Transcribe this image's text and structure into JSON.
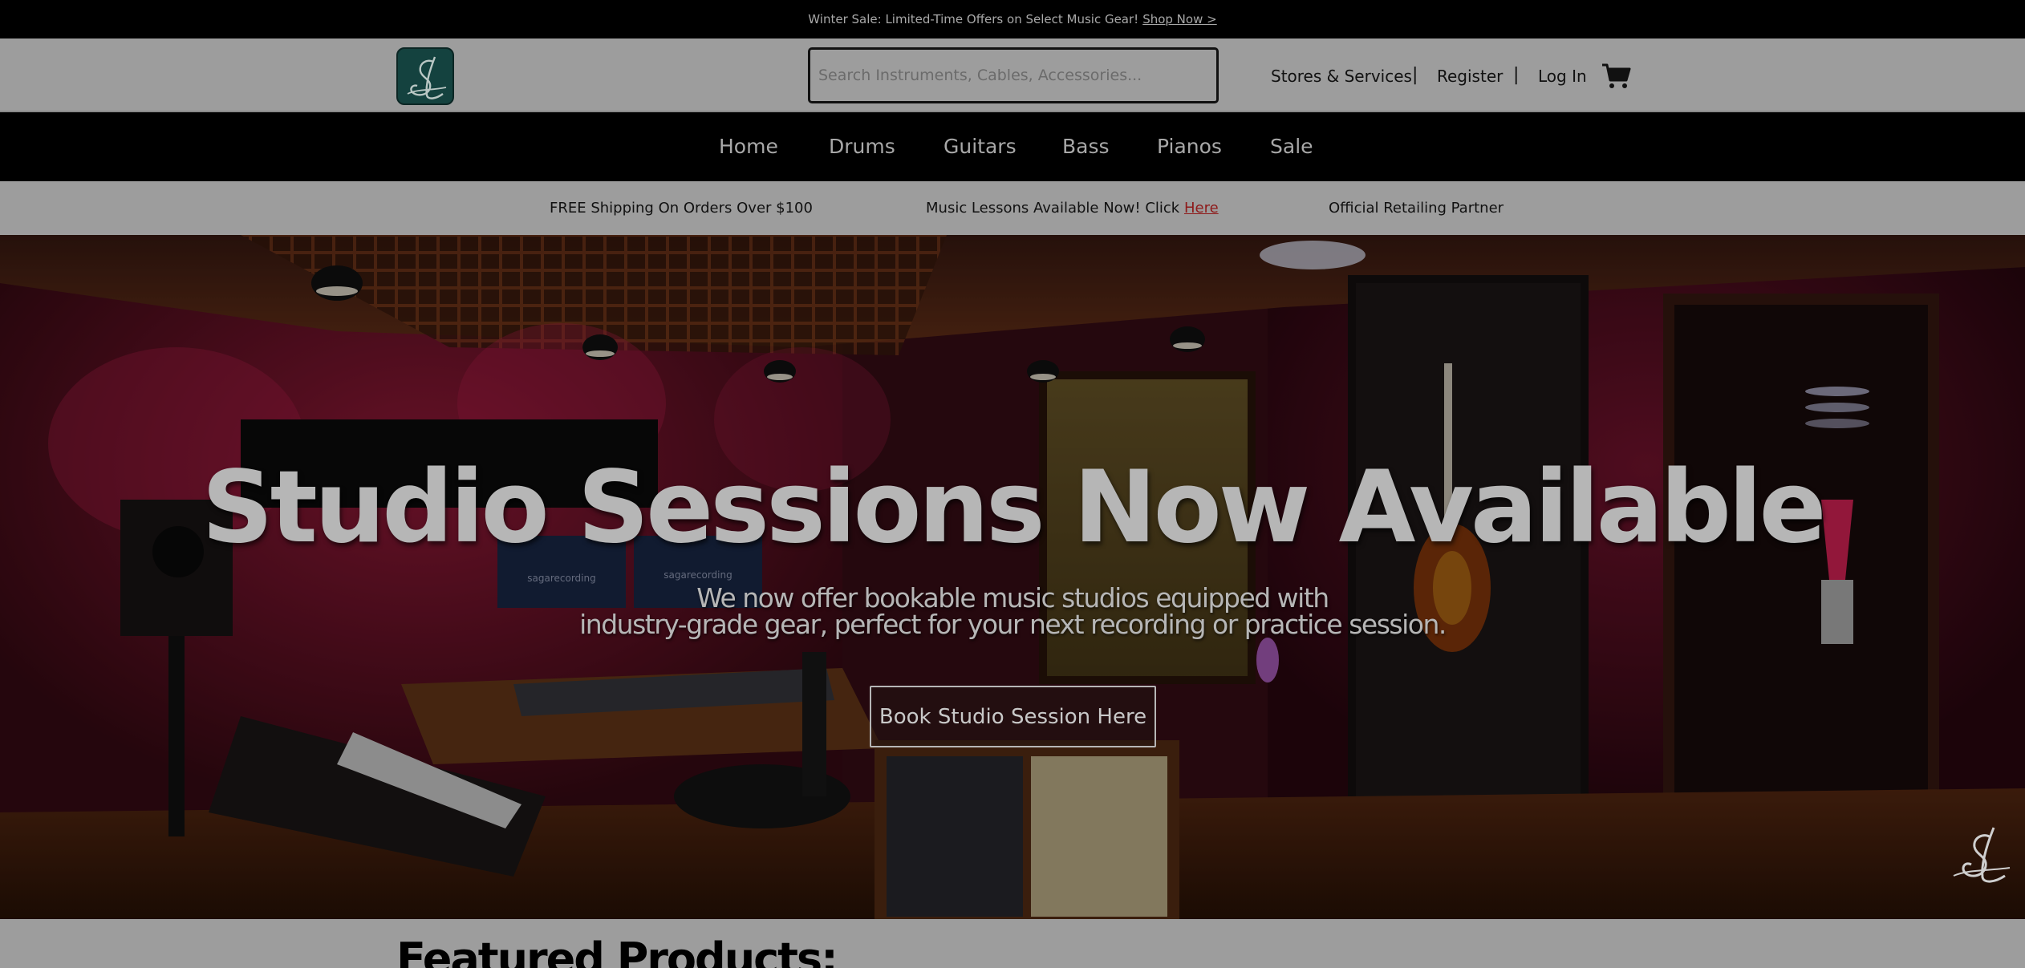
{
  "promo": {
    "text": "Winter Sale: Limited-Time Offers on Select Music Gear!",
    "link": "Shop Now >"
  },
  "header": {
    "search_placeholder": "Search Instruments, Cables, Accessories...",
    "links": {
      "stores": "Stores & Services",
      "sep1": "|",
      "register": "Register",
      "sep2": "|",
      "login": "Log In"
    }
  },
  "nav": {
    "items": [
      "Home",
      "Drums",
      "Guitars",
      "Bass",
      "Pianos",
      "Sale"
    ]
  },
  "info": {
    "shipping": "FREE Shipping On Orders Over $100",
    "lessons_text": "Music Lessons Available Now! Click",
    "lessons_link": "Here",
    "partner": "Official Retailing Partner"
  },
  "hero": {
    "title": "Studio Sessions Now Available",
    "subtitle_line1": "We now offer bookable music studios equipped with",
    "subtitle_line2": "industry-grade gear, perfect for your next recording or practice session.",
    "button": "Book Studio Session Here",
    "screen_text": "sagarecording"
  },
  "featured": {
    "heading": "Featured Products:"
  },
  "colors": {
    "brand_teal": "#14423f",
    "link_red": "#8e1b1b"
  }
}
